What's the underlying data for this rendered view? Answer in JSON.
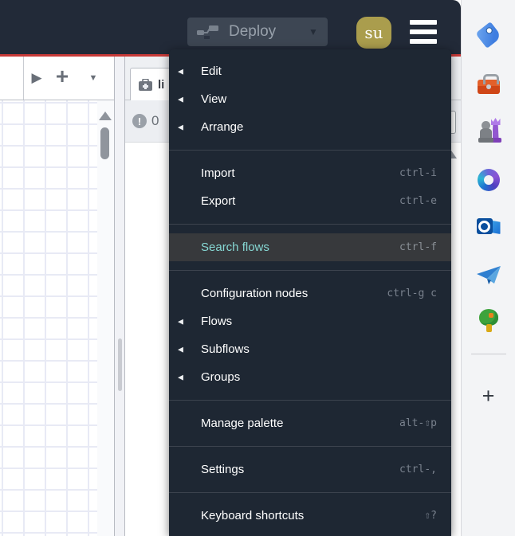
{
  "header": {
    "deploy_label": "Deploy",
    "avatar_initials": "su",
    "icons": {
      "deploy": "deploy-nodes-icon",
      "menu": "hamburger-icon",
      "deploy_chevron": "▼"
    }
  },
  "menu": {
    "groups": [
      {
        "items": [
          {
            "label": "Edit",
            "arrow": true
          },
          {
            "label": "View",
            "arrow": true
          },
          {
            "label": "Arrange",
            "arrow": true
          }
        ]
      },
      {
        "items": [
          {
            "label": "Import",
            "shortcut": "ctrl-i"
          },
          {
            "label": "Export",
            "shortcut": "ctrl-e"
          }
        ]
      },
      {
        "items": [
          {
            "label": "Search flows",
            "shortcut": "ctrl-f",
            "highlighted": true
          }
        ]
      },
      {
        "items": [
          {
            "label": "Configuration nodes",
            "shortcut": "ctrl-g c"
          },
          {
            "label": "Flows",
            "arrow": true
          },
          {
            "label": "Subflows",
            "arrow": true
          },
          {
            "label": "Groups",
            "arrow": true
          }
        ]
      },
      {
        "items": [
          {
            "label": "Manage palette",
            "shortcut": "alt-⇧p"
          }
        ]
      },
      {
        "items": [
          {
            "label": "Settings",
            "shortcut": "ctrl-,"
          }
        ]
      },
      {
        "items": [
          {
            "label": "Keyboard shortcuts",
            "shortcut": "⇧?"
          }
        ]
      }
    ],
    "submenu_arrow_glyph": "◀",
    "colors": {
      "highlight_bg": "#37393c",
      "highlight_text": "#86d8d4",
      "accent_red": "#c83a38"
    }
  },
  "workspace": {
    "tabbar": {
      "scroll_glyph": "▶",
      "add_glyph": "+",
      "list_glyph": "▼"
    },
    "sidebar_tab": {
      "label": "li",
      "icon": "medkit-icon"
    },
    "issues": {
      "count": "0",
      "icon": "exclamation-circle-icon"
    }
  },
  "browser_sidebar": {
    "icons": [
      "tag-icon",
      "toolbox-icon",
      "chess-icon",
      "m365-icon",
      "outlook-icon",
      "paper-plane-icon",
      "tree-icon"
    ],
    "add_label": "+"
  }
}
